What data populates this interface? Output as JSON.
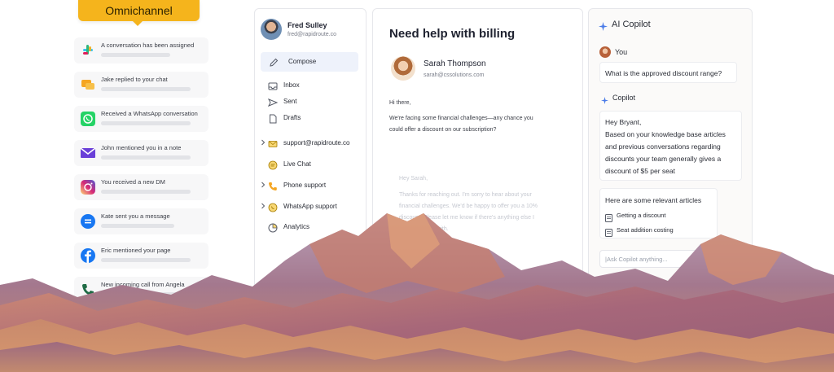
{
  "omnichannel": {
    "badge": "Omnichannel",
    "notifications": [
      {
        "text": "A conversation has been assigned",
        "icon": "slack-icon"
      },
      {
        "text": "Jake replied to your chat",
        "icon": "chat-bubble-icon"
      },
      {
        "text": "Received a WhatsApp conversation",
        "icon": "whatsapp-icon"
      },
      {
        "text": "John mentioned you in a note",
        "icon": "mail-icon"
      },
      {
        "text": "You received a new DM",
        "icon": "instagram-icon"
      },
      {
        "text": "Kate sent you a message",
        "icon": "messenger-icon"
      },
      {
        "text": "Eric mentioned your page",
        "icon": "facebook-icon"
      },
      {
        "text": "New incoming call from Angela",
        "icon": "phone-icon"
      }
    ]
  },
  "sidebar": {
    "user_name": "Fred Sulley",
    "user_email": "fred@rapidroute.co",
    "compose_label": "Compose",
    "items": [
      {
        "label": "Inbox",
        "icon": "inbox-icon"
      },
      {
        "label": "Sent",
        "icon": "send-icon"
      },
      {
        "label": "Drafts",
        "icon": "draft-icon"
      },
      {
        "label": "support@rapidroute.co",
        "icon": "envelope-icon"
      },
      {
        "label": "Live Chat",
        "icon": "live-chat-icon"
      },
      {
        "label": "Phone support",
        "icon": "phone-icon"
      },
      {
        "label": "WhatsApp support",
        "icon": "whatsapp-icon"
      },
      {
        "label": "Analytics",
        "icon": "analytics-icon"
      }
    ]
  },
  "email": {
    "subject": "Need help with billing",
    "sender_name": "Sarah Thompson",
    "sender_email": "sarah@cssolutions.com",
    "greeting": "Hi there,",
    "body": [
      "We're facing some financial challenges—any chance you",
      "could offer a discount on our subscription?"
    ],
    "reply": [
      "Hey Sarah,",
      "Thanks for reaching out. I'm sorry to hear about your",
      "financial challenges. We'd be happy to offer you a 10%",
      "discount. Please let me know if there's anything else I",
      "can assist you with."
    ]
  },
  "copilot": {
    "title": "AI Copilot",
    "you_label": "You",
    "question": "What is the approved discount range?",
    "copilot_label": "Copilot",
    "answer": [
      "Hey Bryant,",
      "Based on your knowledge base articles",
      "and previous conversations regarding",
      "discounts your team generally gives a",
      "discount of $5 per seat"
    ],
    "articles_title": "Here are some relevant articles",
    "articles": [
      "Getting a discount",
      "Seat addition costing"
    ],
    "ask_placeholder": "|Ask Copilot anything..."
  },
  "colors": {
    "accent_badge": "#f5b41c",
    "compose_bg": "#eef2fb",
    "copilot_spark": "#4a7be8"
  }
}
